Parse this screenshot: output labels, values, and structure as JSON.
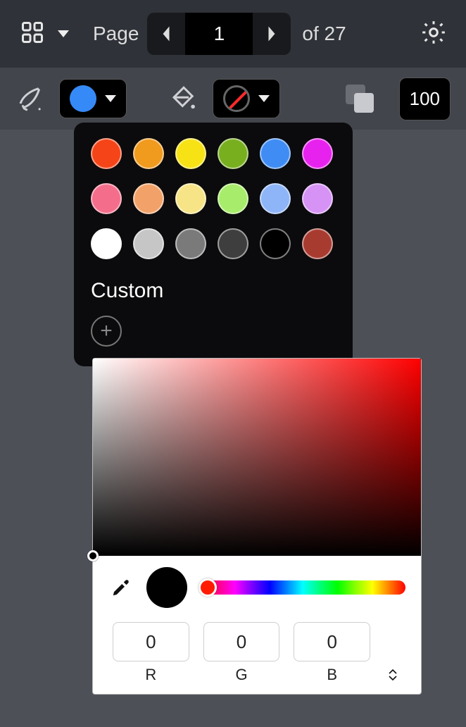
{
  "toolbar": {
    "page_label": "Page",
    "page_current": "1",
    "page_total_label": "of 27",
    "opacity_value": "100"
  },
  "stroke": {
    "current_color": "#368af7"
  },
  "fill": {
    "mode": "none"
  },
  "palette": {
    "swatches": [
      "#f54417",
      "#f09a1e",
      "#f7e216",
      "#78af1f",
      "#3f8cf4",
      "#e822ee",
      "#f46e8b",
      "#f2a269",
      "#f6e487",
      "#a7ec6a",
      "#8eb5f7",
      "#d693f5",
      "#ffffff",
      "#c6c6c6",
      "#7a7a7a",
      "#3e3e3e",
      "#000000",
      "#a83b30"
    ],
    "custom_label": "Custom"
  },
  "picker": {
    "current_hex": "#000000",
    "hue_hex": "#ff1c00",
    "r": "0",
    "g": "0",
    "b": "0",
    "r_label": "R",
    "g_label": "G",
    "b_label": "B"
  }
}
